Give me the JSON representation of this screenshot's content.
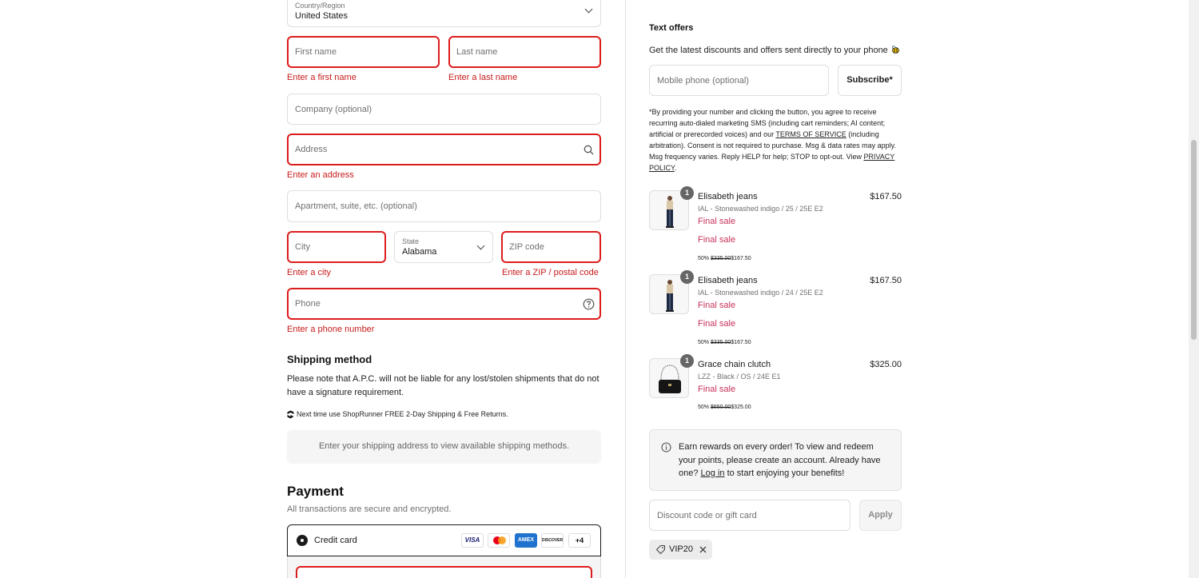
{
  "address": {
    "country": {
      "label": "Country/Region",
      "value": "United States"
    },
    "first_name": {
      "placeholder": "First name",
      "error": "Enter a first name"
    },
    "last_name": {
      "placeholder": "Last name",
      "error": "Enter a last name"
    },
    "company": {
      "placeholder": "Company (optional)"
    },
    "address": {
      "placeholder": "Address",
      "error": "Enter an address"
    },
    "apartment": {
      "placeholder": "Apartment, suite, etc. (optional)"
    },
    "city": {
      "placeholder": "City",
      "error": "Enter a city"
    },
    "state": {
      "label": "State",
      "value": "Alabama"
    },
    "zip": {
      "placeholder": "ZIP code",
      "error": "Enter a ZIP / postal code"
    },
    "phone": {
      "placeholder": "Phone",
      "error": "Enter a phone number"
    }
  },
  "shipping": {
    "title": "Shipping method",
    "note": "Please note that A.P.C. will not be liable for any lost/stolen shipments that do not have a signature requirement.",
    "shoprunner": "Next time use ShopRunner FREE 2-Day Shipping & Free Returns.",
    "empty_msg": "Enter your shipping address to view available shipping methods."
  },
  "payment": {
    "title": "Payment",
    "subtitle": "All transactions are secure and encrypted.",
    "method_label": "Credit card",
    "cards": [
      "VISA",
      "MC",
      "AMEX",
      "DISCOVER"
    ],
    "more_cards": "+4"
  },
  "text_offers": {
    "title": "Text offers",
    "desc": "Get the latest discounts and offers sent directly to your phone",
    "phone_placeholder": "Mobile phone (optional)",
    "subscribe_label": "Subscribe*",
    "legal_1": "*By providing your number and clicking the button, you agree to receive recurring auto-dialed marketing SMS (including cart reminders; AI content; artificial or prerecorded voices) and our ",
    "terms_link": "TERMS OF SERVICE",
    "legal_2": " (including arbitration). Consent is not required to purchase. Msg & data rates may apply. Msg frequency varies. Reply HELP for help; STOP to opt-out. View ",
    "privacy_link": "PRIVACY POLICY",
    "legal_3": "."
  },
  "cart": {
    "items": [
      {
        "qty": "1",
        "name": "Elisabeth jeans",
        "variant": "IAL - Stonewashed indigo / 25 / 25E E2",
        "price": "$167.50",
        "final_1": "Final sale",
        "final_2": "Final sale",
        "disc_pct": "50%",
        "disc_old": "$335.00",
        "disc_new": "$167.50"
      },
      {
        "qty": "1",
        "name": "Elisabeth jeans",
        "variant": "IAL - Stonewashed indigo / 24 / 25E E2",
        "price": "$167.50",
        "final_1": "Final sale",
        "final_2": "Final sale",
        "disc_pct": "50%",
        "disc_old": "$335.00",
        "disc_new": "$167.50"
      },
      {
        "qty": "1",
        "name": "Grace chain clutch",
        "variant": "LZZ - Black / OS / 24E E1",
        "price": "$325.00",
        "final_1": "Final sale",
        "disc_pct": "50%",
        "disc_old": "$650.00",
        "disc_new": "$325.00"
      }
    ]
  },
  "rewards": {
    "text_1": "Earn rewards on every order! To view and redeem your points, please create an account. Already have one? ",
    "login_link": "Log in",
    "text_2": " to start enjoying your benefits!"
  },
  "discount": {
    "placeholder": "Discount code or gift card",
    "apply_label": "Apply",
    "applied_code": "VIP20"
  }
}
